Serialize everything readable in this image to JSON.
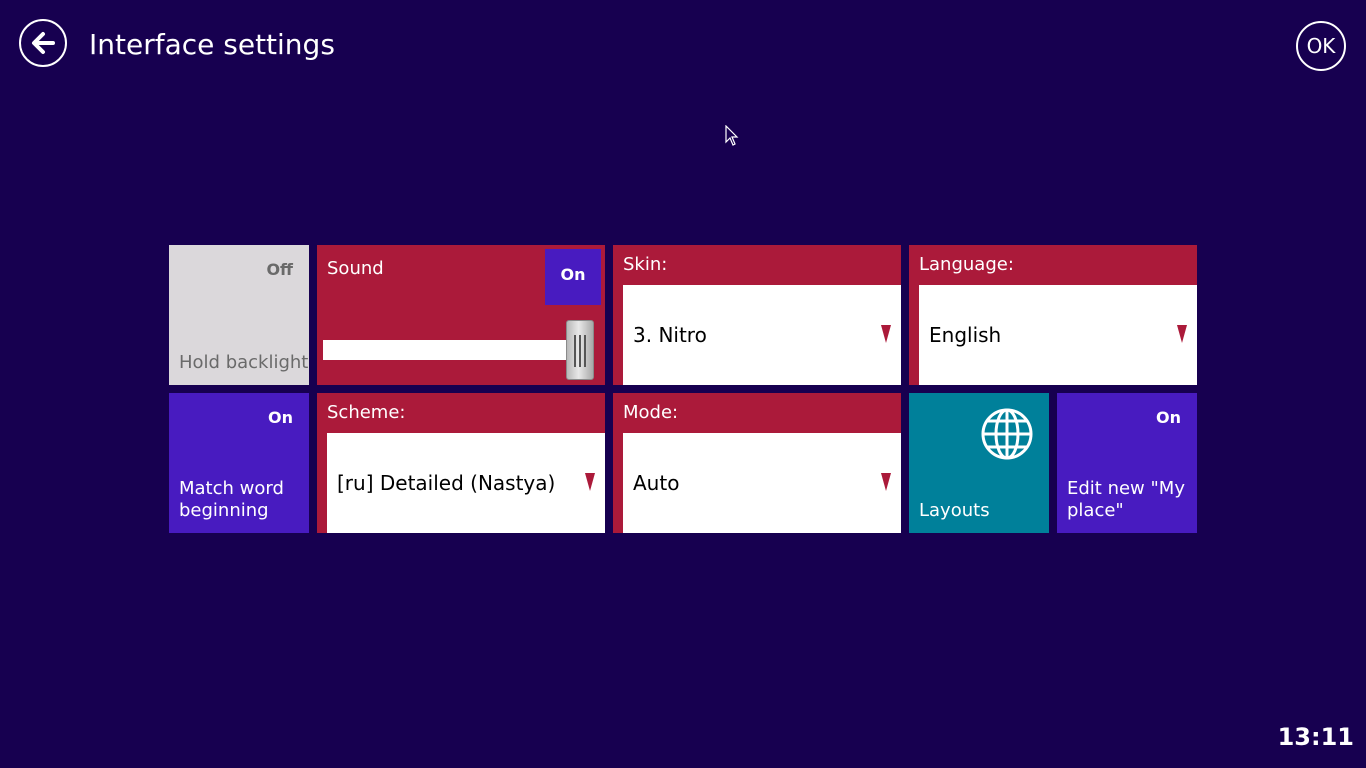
{
  "header": {
    "title": "Interface settings",
    "ok_label": "OK"
  },
  "tiles": {
    "hold_backlight": {
      "label": "Hold backlight",
      "state": "Off"
    },
    "sound": {
      "label": "Sound",
      "state": "On",
      "volume_percent": 100
    },
    "skin": {
      "label": "Skin:",
      "value": "3. Nitro"
    },
    "language": {
      "label": "Language:",
      "value": "English"
    },
    "match_word": {
      "label": "Match word beginning",
      "state": "On"
    },
    "scheme": {
      "label": "Scheme:",
      "value": "[ru] Detailed (Nastya)"
    },
    "mode": {
      "label": "Mode:",
      "value": "Auto"
    },
    "layouts": {
      "label": "Layouts"
    },
    "edit_my_place": {
      "label": "Edit new \"My place\"",
      "state": "On"
    }
  },
  "status": {
    "clock": "13:11"
  },
  "colors": {
    "background": "#170050",
    "crimson": "#ab1a3a",
    "purple": "#481bc0",
    "teal": "#00809a",
    "disabled_gray": "#dbd8db"
  },
  "icons": [
    "back-arrow-icon",
    "globe-icon",
    "dropdown-arrow-icon",
    "mouse-cursor-icon"
  ]
}
